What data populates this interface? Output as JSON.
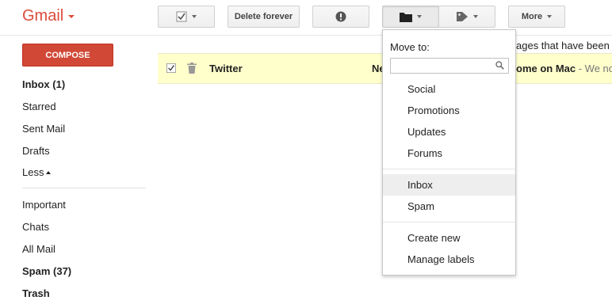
{
  "app": {
    "brand": "Gmail"
  },
  "toolbar": {
    "delete_forever_label": "Delete forever",
    "more_label": "More"
  },
  "sidebar": {
    "compose_label": "COMPOSE",
    "items": [
      {
        "label": "Inbox (1)"
      },
      {
        "label": "Starred"
      },
      {
        "label": "Sent Mail"
      },
      {
        "label": "Drafts"
      },
      {
        "label": "Less"
      },
      {
        "label": "Important"
      },
      {
        "label": "Chats"
      },
      {
        "label": "All Mail"
      },
      {
        "label": "Spam (37)"
      },
      {
        "label": "Trash"
      }
    ]
  },
  "banner_text": "ages that have been i",
  "email_row": {
    "sender": "Twitter",
    "subject_prefix": "Ne",
    "subject": "ome on Mac",
    "snippet": " - We not"
  },
  "move_menu": {
    "heading": "Move to:",
    "search_placeholder": "",
    "items": [
      {
        "label": "Social"
      },
      {
        "label": "Promotions"
      },
      {
        "label": "Updates"
      },
      {
        "label": "Forums"
      },
      {
        "label": "Inbox"
      },
      {
        "label": "Spam"
      },
      {
        "label": "Create new"
      },
      {
        "label": "Manage labels"
      }
    ]
  },
  "colors": {
    "brand": "#dd4b39",
    "compose": "#d14836",
    "row_highlight": "#ffffcc",
    "menu_hover": "#eeeeee"
  }
}
